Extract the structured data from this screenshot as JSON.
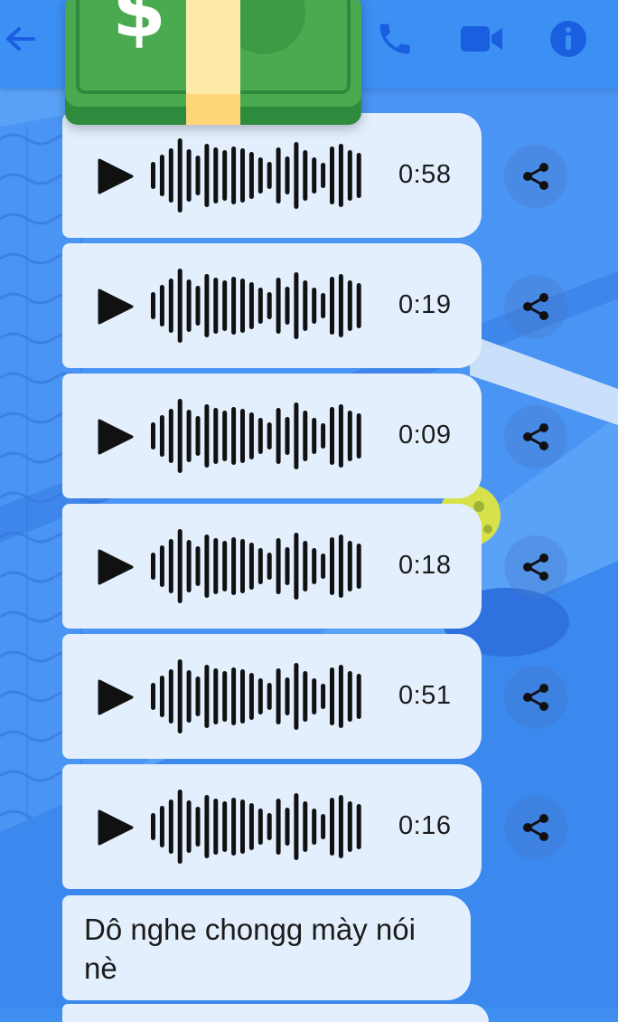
{
  "header": {
    "back_icon": "arrow-left-icon",
    "call_icon": "phone-icon",
    "video_icon": "video-camera-icon",
    "info_icon": "info-icon",
    "accent": "#1a5fe0",
    "background": "#3c8ff3"
  },
  "sticker": {
    "icon": "money-bill-icon",
    "symbol": "$"
  },
  "voice_messages": [
    {
      "duration": "0:58"
    },
    {
      "duration": "0:19"
    },
    {
      "duration": "0:09"
    },
    {
      "duration": "0:18"
    },
    {
      "duration": "0:51"
    },
    {
      "duration": "0:16"
    }
  ],
  "text_message": {
    "text": "Dô nghe chongg mày nói nè"
  },
  "colors": {
    "bubble": "#e3effd",
    "text": "#1b1b1b"
  }
}
